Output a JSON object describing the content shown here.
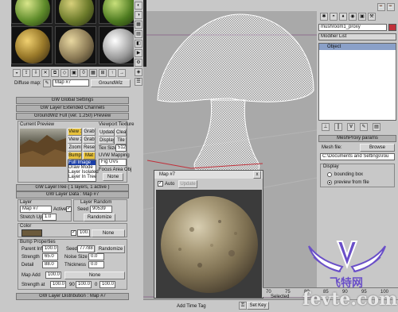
{
  "viewport": {
    "bg_color": "#a9a9a9",
    "grid_color": "#b3b3b3"
  },
  "material_editor": {
    "map_dropdown": "Diffuse map:",
    "map_name": "Map #7",
    "map_type": "GroundWiz",
    "rollouts": {
      "global": "GW Global Settings",
      "extended": "GW Layer Extended Channels",
      "title": "GroundWiz Full (ver. 1.250) Preview"
    },
    "preview": {
      "current_preview": "Current Preview",
      "view1": "View 1",
      "view2": "View 2",
      "grab": "Grab",
      "zoom": "Zoom",
      "reset": "Reset",
      "bump": "Bump",
      "mat": "Mat",
      "list_items": [
        "Full Image",
        "Draw Mode",
        "Layer Isolated",
        "Layer In Tree"
      ],
      "viewport_texture": "Viewport Texture",
      "update": "Update",
      "clear": "Clear",
      "display": "Display",
      "tile": "Tile",
      "tex_size": "Tex Size",
      "tex_size_value": "512",
      "uvw_mapping": "UVW Mapping",
      "uvw_value": "Fig  UVs",
      "focus_area": "Focus Area Obj",
      "focus_value": "None"
    },
    "layer_tree": "GW LayerTree  ( 1 layers, 1 active )",
    "layer_data": "GW Layer Data : Map #7",
    "layer": {
      "label": "Layer",
      "name_value": "Map #7",
      "active_label": "Active",
      "stretch_up_label": "Stretch Up",
      "stretch_up_value": "1.0",
      "random_label": "Layer Random",
      "seed_label": "Seed",
      "seed_value": "90539",
      "randomize": "Randomize"
    },
    "color": {
      "label": "Color",
      "swatch_color": "#6b5a3c",
      "amount": "100.0",
      "map_none": "None"
    },
    "bump": {
      "label": "Bump Properties",
      "parent_inf_label": "Parent Inf.",
      "parent_inf_value": "100.0",
      "seed_label": "Seed",
      "seed_value": "77788",
      "randomize": "Randomize",
      "strength_label": "Strength",
      "strength_value": "65.0",
      "noise_size_label": "Noise Size",
      "noise_size_value": "0.0",
      "detail_label": "Detail",
      "detail_value": "88.0",
      "thickness_label": "Thickness",
      "thickness_value": "0.0",
      "map_add_label": "Map Add",
      "map_add_value": "100.0",
      "map_add_none": "None",
      "strength_at_label": "Strength at",
      "strength_at_value": "100.0",
      "v90": "90",
      "v90_value": "100.0",
      "v0": "0",
      "v0_value": "100.0"
    },
    "layer_distribution": "GW Layer Distribution : Map #7"
  },
  "map_window": {
    "title": "Map #7",
    "auto": "Auto",
    "update": "Update",
    "close": "x"
  },
  "command_panel": {
    "object_name": "mushroom1_proxy",
    "modifier_list": "Modifier List",
    "stack_item": "Object",
    "meshproxy_params": "MeshProxy params",
    "mesh_file_label": "Mesh file:",
    "browse": "Browse",
    "mesh_path": "C:\\Documents and Settings\\rou",
    "display_label": "Display",
    "bounding_box": "bounding box",
    "preview_from_file": "preview from file"
  },
  "timeline": {
    "ticks": [
      "70",
      "75",
      "80",
      "85",
      "90",
      "95",
      "100"
    ],
    "add_time_tag": "Add Time Tag",
    "set_key": "Set Key",
    "selected": "Selected"
  },
  "watermark": {
    "cn_text": "飞特网",
    "site": "fevte.com"
  }
}
